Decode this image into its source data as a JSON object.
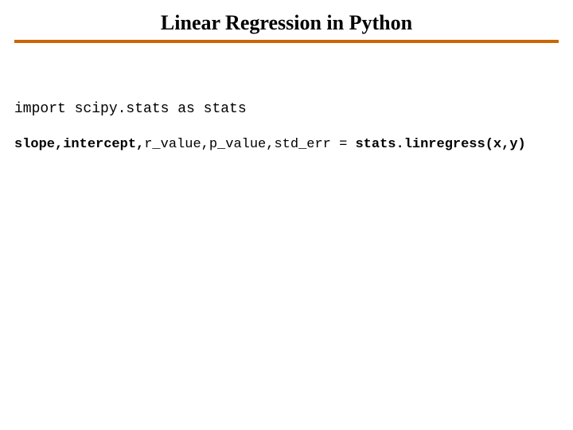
{
  "title": "Linear Regression in Python",
  "code": {
    "line1": "import scipy.stats as stats",
    "line2": {
      "p1": "slope,intercept,",
      "p2": "r_value,p_value,std_err",
      "p3": " = ",
      "p4": "stats.linregress(x,y)"
    }
  }
}
